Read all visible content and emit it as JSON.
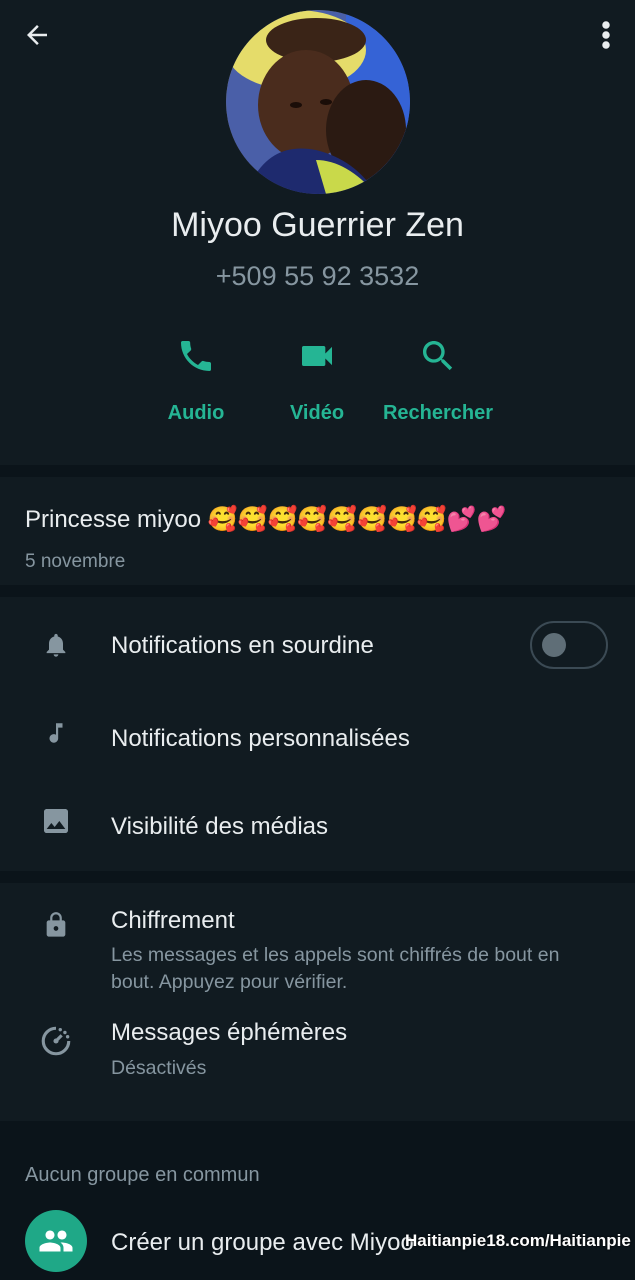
{
  "contact": {
    "name": "Miyoo Guerrier Zen",
    "phone": "+509 55 92 3532"
  },
  "actions": [
    {
      "label": "Audio",
      "icon": "phone-icon"
    },
    {
      "label": "Vidéo",
      "icon": "video-icon"
    },
    {
      "label": "Rechercher",
      "icon": "search-icon"
    }
  ],
  "about": {
    "text": "Princesse miyoo 🥰🥰🥰🥰🥰🥰🥰🥰💕💕",
    "date": "5 novembre"
  },
  "settings": {
    "mute": {
      "label": "Notifications en sourdine",
      "icon": "bell-icon",
      "enabled": false
    },
    "custom": {
      "label": "Notifications personnalisées",
      "icon": "music-note-icon"
    },
    "media": {
      "label": "Visibilité des médias",
      "icon": "image-icon"
    }
  },
  "privacy": {
    "encryption": {
      "label": "Chiffrement",
      "description": "Les messages et les appels sont chiffrés de bout en bout. Appuyez pour vérifier.",
      "icon": "lock-icon"
    },
    "disappearing": {
      "label": "Messages éphémères",
      "status": "Désactivés",
      "icon": "timer-icon"
    }
  },
  "groups": {
    "heading": "Aucun groupe en commun",
    "create_label": "Créer un groupe avec Miyoo"
  },
  "watermark": "Haitianpie18.com/Haitianpie",
  "colors": {
    "background": "#0b141a",
    "panel": "#111b21",
    "accent": "#25b594",
    "secondary_text": "#8696a0"
  }
}
